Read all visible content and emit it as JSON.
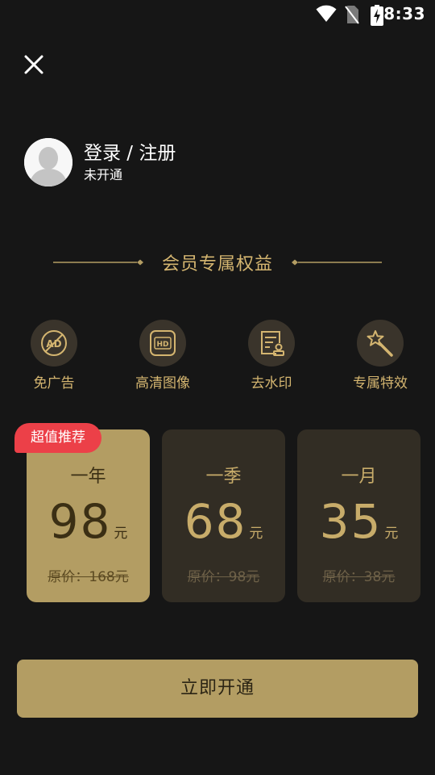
{
  "status_bar": {
    "time": "8:33",
    "icons": [
      "wifi-icon",
      "no-sim-icon",
      "battery-charging-icon"
    ]
  },
  "header": {
    "close_icon": "close-icon"
  },
  "profile": {
    "login_label": "登录 / 注册",
    "status": "未开通",
    "avatar_icon": "default-avatar"
  },
  "benefits": {
    "title": "会员专属权益",
    "items": [
      {
        "label": "免广告",
        "icon": "no-ad-icon"
      },
      {
        "label": "高清图像",
        "icon": "hd-icon"
      },
      {
        "label": "去水印",
        "icon": "remove-watermark-icon"
      },
      {
        "label": "专属特效",
        "icon": "magic-wand-icon"
      }
    ]
  },
  "plans": [
    {
      "name": "一年",
      "price": "98",
      "unit": "元",
      "original": "原价：168元",
      "selected": true
    },
    {
      "name": "一季",
      "price": "68",
      "unit": "元",
      "original": "原价：98元",
      "selected": false
    },
    {
      "name": "一月",
      "price": "35",
      "unit": "元",
      "original": "原价：38元",
      "selected": false
    }
  ],
  "badge": "超值推荐",
  "cta": "立即开通",
  "colors": {
    "background": "#161616",
    "gold": "#b39d63",
    "gold_text": "#d4b570",
    "card_dark": "#322d24",
    "badge_red": "#ec4048"
  }
}
